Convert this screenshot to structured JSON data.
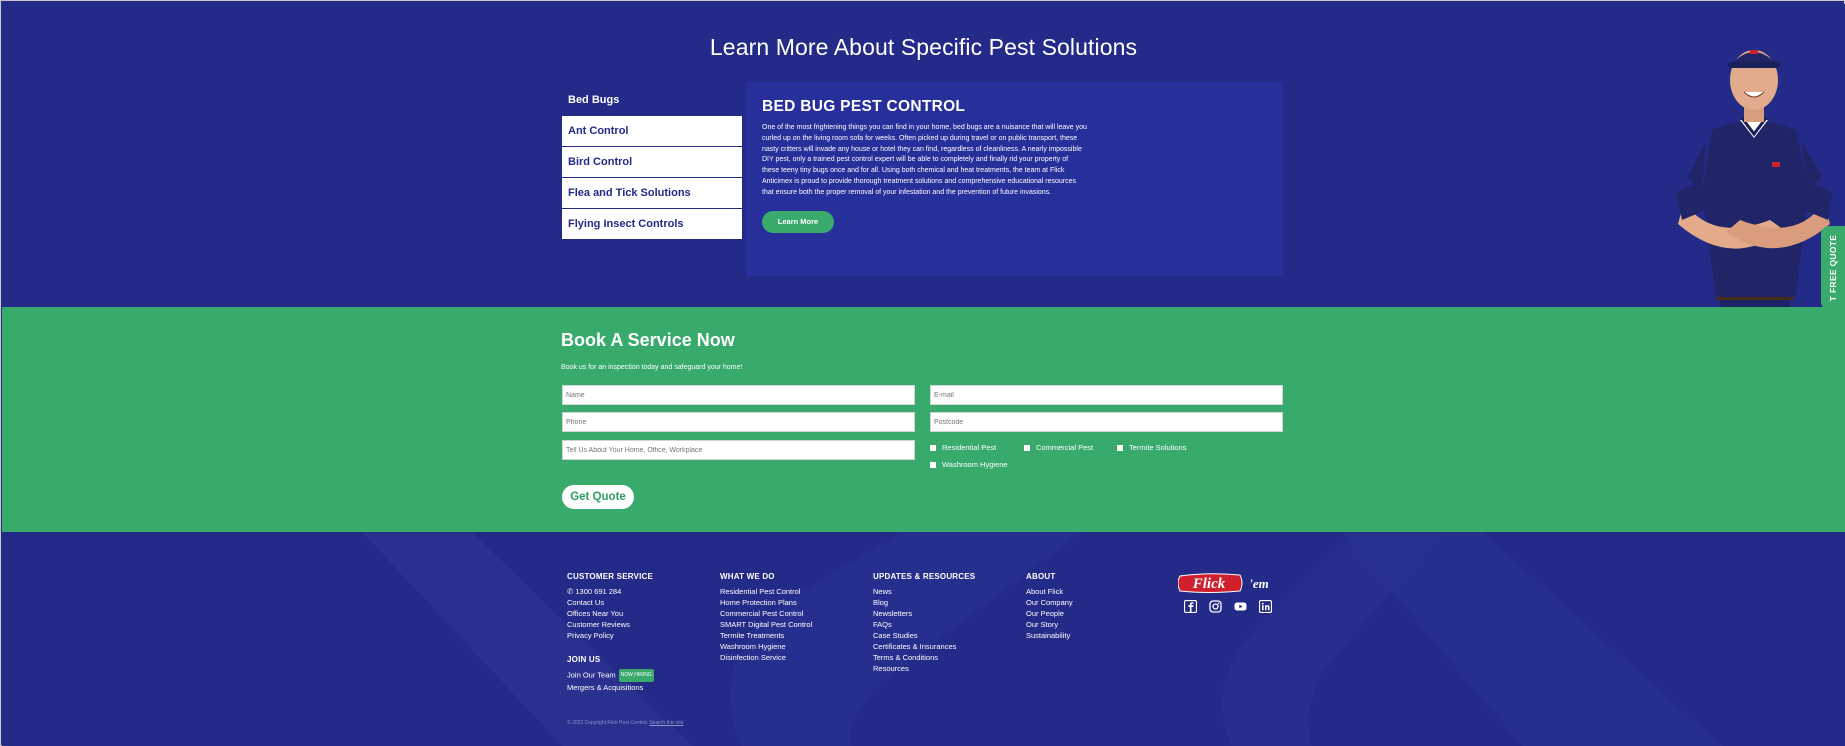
{
  "solutions": {
    "title": "Learn More About Specific Pest Solutions",
    "tabs": [
      "Bed Bugs",
      "Ant Control",
      "Bird Control",
      "Flea and Tick Solutions",
      "Flying Insect Controls"
    ],
    "active_tab": 0,
    "panel": {
      "heading": "BED BUG PEST CONTROL",
      "body": "One of the most frightening things you can find in your home, bed bugs are a nuisance that will leave you curled up on the living room sofa for weeks. Often picked up during travel or on public transport, these nasty critters will invade any house or hotel they can find, regardless of cleanliness. A nearly impossible DIY pest, only a trained pest control expert will be able to completely and finally rid your property of these teeny tiny bugs once and for all. Using both chemical and heat treatments, the team at Flick Anticimex is proud to provide thorough treatment solutions and comprehensive educational resources that ensure both the proper removal of your infestation and the prevention of future invasions.",
      "button": "Learn More"
    },
    "quote_tab": "T FREE QUOTE"
  },
  "book": {
    "title": "Book A Service Now",
    "subtitle": "Book us for an inspection today and safeguard your home!",
    "name_placeholder": "Name",
    "email_placeholder": "E-mail",
    "phone_placeholder": "Phone",
    "postcode_placeholder": "Postcode",
    "message_placeholder": "Tell Us About Your Home, Office, Workplace",
    "services": [
      "Residential Pest",
      "Commercial Pest",
      "Termite Solutions",
      "Washroom Hygiene"
    ],
    "submit": "Get Quote"
  },
  "footer": {
    "customer_service": {
      "title": "CUSTOMER SERVICE",
      "phone": "1300 691 284",
      "links": [
        "Contact Us",
        "Offices Near You",
        "Customer Reviews",
        "Privacy Policy"
      ]
    },
    "join_us": {
      "title": "JOIN US",
      "team_link": "Join Our Team",
      "badge": "NOW HIRING",
      "mergers": "Mergers & Acquisitions"
    },
    "what_we_do": {
      "title": "WHAT WE DO",
      "links": [
        "Residential Pest Control",
        "Home Protection Plans",
        "Commercial Pest Control",
        "SMART Digital Pest Control",
        "Termite Treatments",
        "Washroom Hygiene",
        "Disinfection Service"
      ]
    },
    "updates": {
      "title": "UPDATES & RESOURCES",
      "links": [
        "News",
        "Blog",
        "Newsletters",
        "FAQs",
        "Case Studies",
        "Certificates & Insurances",
        "Terms & Conditions",
        "Resources"
      ]
    },
    "about": {
      "title": "ABOUT",
      "links": [
        "About Flick",
        "Our Company",
        "Our People",
        "Our Story",
        "Sustainability"
      ]
    },
    "logo_text": "Flick",
    "logo_tagline": "'em",
    "copyright": "© 2023 Copyright Flick Pest Control.",
    "search_link": "Search this site"
  },
  "colors": {
    "navy": "#232a87",
    "green": "#38aa6c",
    "logo_red": "#d0202e"
  }
}
